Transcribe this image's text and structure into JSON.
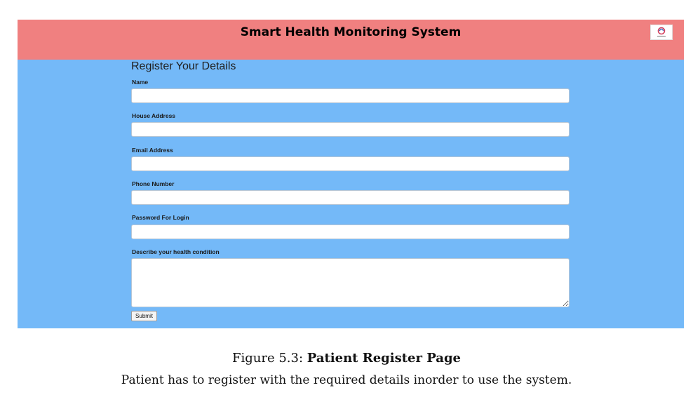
{
  "header": {
    "title": "Smart Health Monitoring System",
    "logo_icon": "heart-logo-icon",
    "background_color": "#f08080"
  },
  "form": {
    "heading": "Register Your Details",
    "background_color": "#74b9f8",
    "fields": [
      {
        "label": "Name",
        "value": "",
        "placeholder": ""
      },
      {
        "label": "House Address",
        "value": "",
        "placeholder": ""
      },
      {
        "label": "Email Address",
        "value": "",
        "placeholder": ""
      },
      {
        "label": "Phone Number",
        "value": "",
        "placeholder": ""
      },
      {
        "label": "Password For Login",
        "value": "",
        "placeholder": ""
      }
    ],
    "textarea": {
      "label": "Describe your health condition",
      "value": "",
      "placeholder": ""
    },
    "submit_label": "Submit"
  },
  "caption": {
    "figure_number": "Figure 5.3:",
    "figure_title": "Patient Register Page",
    "description": "Patient has to register with the required details inorder to use the system."
  }
}
